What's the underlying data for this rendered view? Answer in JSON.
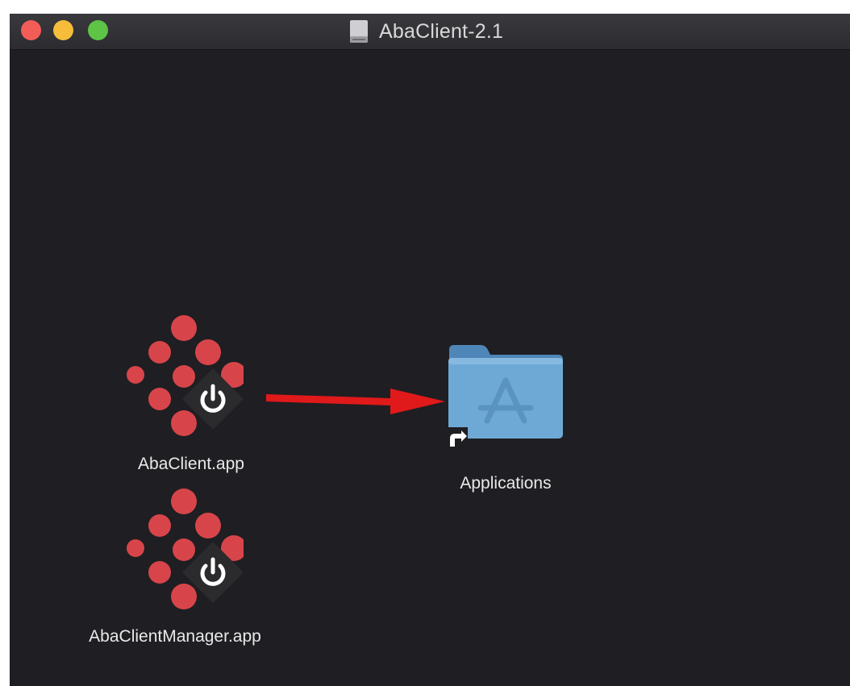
{
  "window": {
    "title": "AbaClient-2.1",
    "title_icon": "disk-image-icon"
  },
  "traffic_lights": {
    "close_color": "#f25d57",
    "minimize_color": "#f6bd3a",
    "zoom_color": "#5dc446"
  },
  "items": [
    {
      "label": "AbaClient.app",
      "icon": "abaclient-app-icon"
    },
    {
      "label": "AbaClientManager.app",
      "icon": "abaclient-manager-app-icon"
    },
    {
      "label": "Applications",
      "icon": "applications-folder-alias-icon"
    }
  ],
  "annotation": {
    "icon": "red-arrow-icon",
    "color": "#e0191a"
  },
  "colors": {
    "background": "#1f1e22",
    "dot_red": "#d7454a",
    "folder_blue": "#6ea9d6"
  }
}
